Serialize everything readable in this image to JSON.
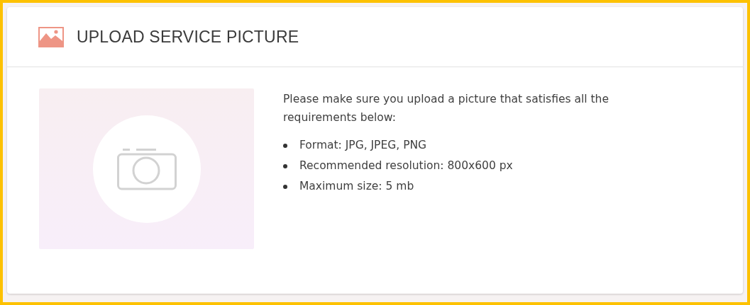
{
  "panel": {
    "title": "UPLOAD SERVICE PICTURE",
    "intro": "Please make sure you upload a picture that satisfies all the requirements below:",
    "requirements": [
      "Format: JPG, JPEG, PNG",
      "Recommended resolution: 800x600 px",
      "Maximum size: 5 mb"
    ]
  }
}
